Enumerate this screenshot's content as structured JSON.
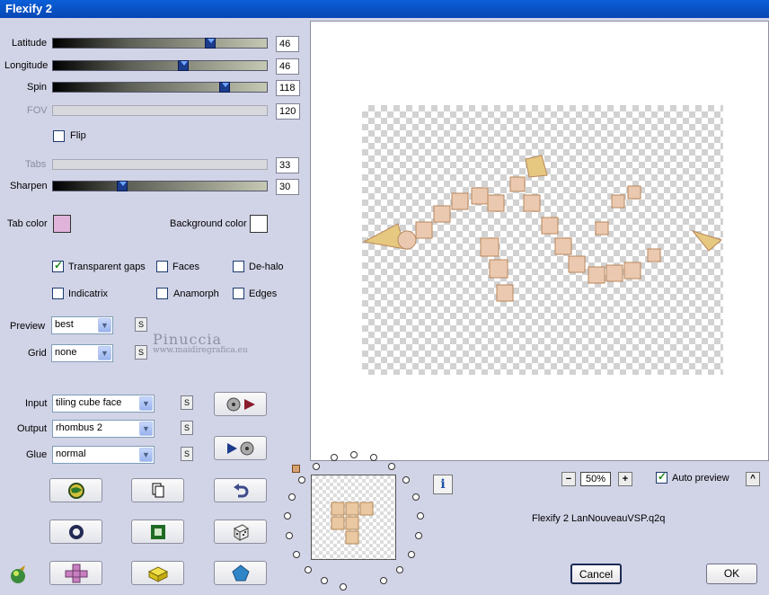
{
  "window": {
    "title": "Flexify 2"
  },
  "sliders": {
    "latitude": {
      "label": "Latitude",
      "value": "46",
      "fraction": 0.74
    },
    "longitude": {
      "label": "Longitude",
      "value": "46",
      "fraction": 0.61
    },
    "spin": {
      "label": "Spin",
      "value": "118",
      "fraction": 0.81
    },
    "fov": {
      "label": "FOV",
      "value": "120"
    },
    "tabs": {
      "label": "Tabs",
      "value": "33"
    },
    "sharpen": {
      "label": "Sharpen",
      "value": "30",
      "fraction": 0.31
    }
  },
  "flip_label": "Flip",
  "tab_color": {
    "label": "Tab color",
    "color": "#e0b3da"
  },
  "background_color": {
    "label": "Background color",
    "color": "#ffffff"
  },
  "options": {
    "transparent_gaps": "Transparent gaps",
    "faces": "Faces",
    "de_halo": "De-halo",
    "indicatrix": "Indicatrix",
    "anamorph": "Anamorph",
    "edges": "Edges"
  },
  "preview": {
    "label": "Preview",
    "value": "best"
  },
  "grid": {
    "label": "Grid",
    "value": "none"
  },
  "input": {
    "label": "Input",
    "value": "tiling cube face"
  },
  "output": {
    "label": "Output",
    "value": "rhombus 2"
  },
  "glue": {
    "label": "Glue",
    "value": "normal"
  },
  "s_label": "S",
  "watermark": {
    "name": "Pinuccia",
    "url": "www.maidiregrafica.eu"
  },
  "zoom": {
    "value": "50%",
    "minus": "−",
    "plus": "+"
  },
  "auto_preview_label": "Auto preview",
  "info_label": "i",
  "caret_label": "^",
  "preset_name": "Flexify 2 LanNouveauVSP.q2q",
  "cancel_label": "Cancel",
  "ok_label": "OK"
}
